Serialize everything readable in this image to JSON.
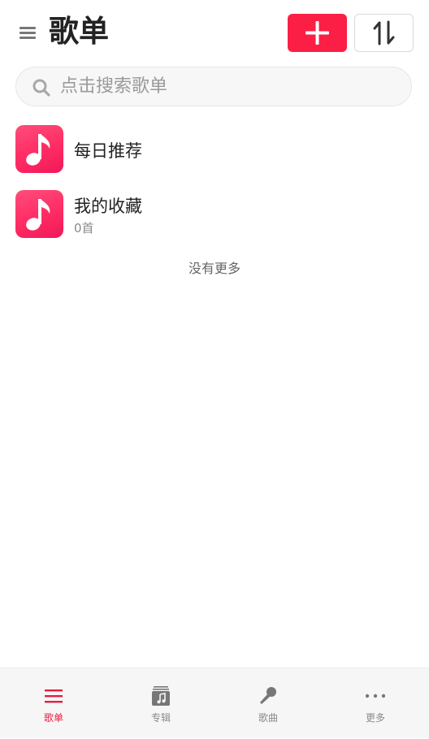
{
  "header": {
    "title": "歌单",
    "menu_icon": "hamburger-menu-icon",
    "add_icon": "plus-icon",
    "sort_icon": "sort-arrows-icon",
    "accent_color": "#fb1f45"
  },
  "search": {
    "placeholder": "点击搜索歌单",
    "value": ""
  },
  "playlists": [
    {
      "title": "每日推荐",
      "subtitle": "",
      "icon": "music-note-icon"
    },
    {
      "title": "我的收藏",
      "subtitle": "0首",
      "icon": "music-note-icon"
    }
  ],
  "list_footer": "没有更多",
  "tabbar": {
    "active_color": "#e81d3e",
    "tabs": [
      {
        "label": "歌单",
        "icon": "list-icon",
        "active": true
      },
      {
        "label": "专辑",
        "icon": "album-icon",
        "active": false
      },
      {
        "label": "歌曲",
        "icon": "microphone-icon",
        "active": false
      },
      {
        "label": "更多",
        "icon": "more-dots-icon",
        "active": false
      }
    ]
  }
}
